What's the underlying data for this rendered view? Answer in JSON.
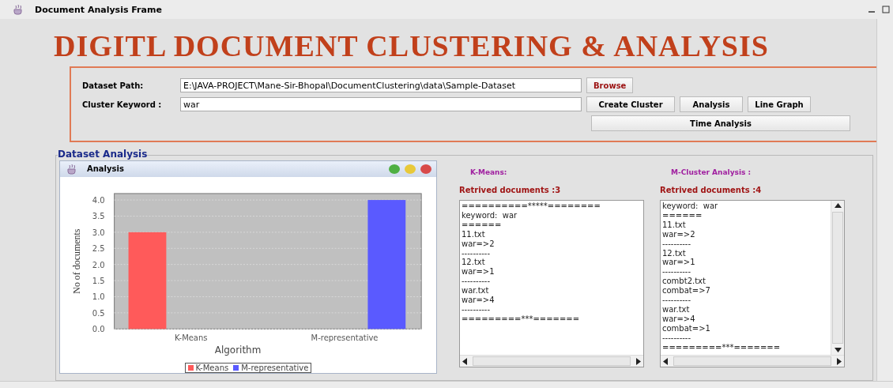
{
  "window": {
    "title": "Document Analysis Frame"
  },
  "heading": "DIGITL DOCUMENT CLUSTERING & ANALYSIS",
  "form": {
    "fields": [
      {
        "label": "Dataset Path:",
        "value": "E:\\JAVA-PROJECT\\Mane-Sir-Bhopal\\DocumentClustering\\data\\Sample-Dataset"
      },
      {
        "label": "Cluster Keyword :",
        "value": "war"
      }
    ],
    "browse_button": "Browse",
    "buttons": [
      "Create Cluster",
      "Analysis",
      "Line Graph"
    ],
    "time_button": "Time Analysis"
  },
  "dataset_analysis": {
    "title": "Dataset Analysis",
    "chart_window": {
      "title": "Analysis",
      "chart_data": {
        "type": "bar",
        "xlabel": "Algorithm",
        "ylabel": "No of documents",
        "categories": [
          "K-Means",
          "M-representative"
        ],
        "series": [
          {
            "name": "K-Means",
            "color": "#ff5a5a",
            "values": [
              3,
              null
            ]
          },
          {
            "name": "M-representative",
            "color": "#5a5aff",
            "values": [
              null,
              4
            ]
          }
        ],
        "ylim": [
          0,
          4.2
        ],
        "grid": true,
        "yticks": [
          {
            "value": 0,
            "label": "0.0"
          },
          {
            "value": 0.5,
            "label": "0.5"
          },
          {
            "value": 1,
            "label": "1.0"
          },
          {
            "value": 1.5,
            "label": "1.5"
          },
          {
            "value": 2,
            "label": "2.0"
          },
          {
            "value": 2.5,
            "label": "2.5"
          },
          {
            "value": 3,
            "label": "3.0"
          },
          {
            "value": 3.5,
            "label": "3.5"
          },
          {
            "value": 4,
            "label": "4.0"
          }
        ]
      }
    },
    "results": [
      {
        "title": "K-Means:",
        "count": "Retrived documents :3",
        "vertical_scroll": false,
        "lines": [
          "==========*****========",
          "keyword:  war",
          "======",
          "11.txt",
          "war=>2",
          "----------",
          "12.txt",
          "war=>1",
          "----------",
          "war.txt",
          "war=>4",
          "----------",
          "=========***======="
        ]
      },
      {
        "title": "M-Cluster Analysis :",
        "count": "Retrived documents :4",
        "vertical_scroll": true,
        "lines": [
          "keyword:  war",
          "======",
          "11.txt",
          "war=>2",
          "----------",
          "12.txt",
          "war=>1",
          "----------",
          "combt2.txt",
          "combat=>7",
          "----------",
          "war.txt",
          "war=>4",
          "combat=>1",
          "----------",
          "=========***======="
        ]
      }
    ]
  }
}
